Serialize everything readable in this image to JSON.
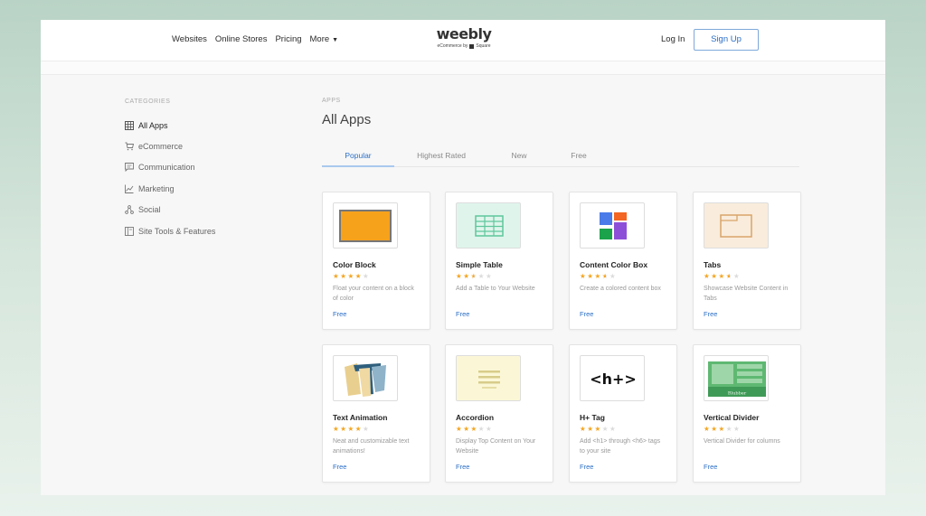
{
  "header": {
    "nav": [
      "Websites",
      "Online Stores",
      "Pricing",
      "More"
    ],
    "logo": "weebly",
    "logo_sub": "eCommerce by",
    "logo_sub_brand": "Square",
    "login": "Log In",
    "signup": "Sign Up"
  },
  "sidebar": {
    "heading": "CATEGORIES",
    "items": [
      {
        "label": "All Apps",
        "icon": "grid-icon"
      },
      {
        "label": "eCommerce",
        "icon": "cart-icon"
      },
      {
        "label": "Communication",
        "icon": "chat-icon"
      },
      {
        "label": "Marketing",
        "icon": "chart-icon"
      },
      {
        "label": "Social",
        "icon": "share-icon"
      },
      {
        "label": "Site Tools & Features",
        "icon": "layout-icon"
      }
    ]
  },
  "main": {
    "crumb": "APPS",
    "title": "All Apps",
    "tabs": [
      "Popular",
      "Highest Rated",
      "New",
      "Free"
    ],
    "active_tab": "Popular"
  },
  "apps": [
    {
      "name": "Color Block",
      "rating": 4,
      "desc": "Float your content on a block of color",
      "price": "Free"
    },
    {
      "name": "Simple Table",
      "rating": 2.5,
      "desc": "Add a Table to Your Website",
      "price": "Free"
    },
    {
      "name": "Content Color Box",
      "rating": 3.5,
      "desc": "Create a colored content box",
      "price": "Free"
    },
    {
      "name": "Tabs",
      "rating": 3.5,
      "desc": "Showcase Website Content in Tabs",
      "price": "Free"
    },
    {
      "name": "Text Animation",
      "rating": 4,
      "desc": "Neat and customizable text animations!",
      "price": "Free"
    },
    {
      "name": "Accordion",
      "rating": 3,
      "desc": "Display Top Content on Your Website",
      "price": "Free"
    },
    {
      "name": "H+ Tag",
      "rating": 3,
      "desc": "Add <h1> through <h6> tags to your site",
      "price": "Free"
    },
    {
      "name": "Vertical Divider",
      "rating": 3,
      "desc": "Vertical Divider for columns",
      "price": "Free"
    }
  ],
  "thumb_text": {
    "htag": "<h+>",
    "divider": "Blubber"
  },
  "colors": {
    "accent": "#2a6ec6",
    "star": "#f5a623",
    "color_block": "#f7a21b"
  }
}
